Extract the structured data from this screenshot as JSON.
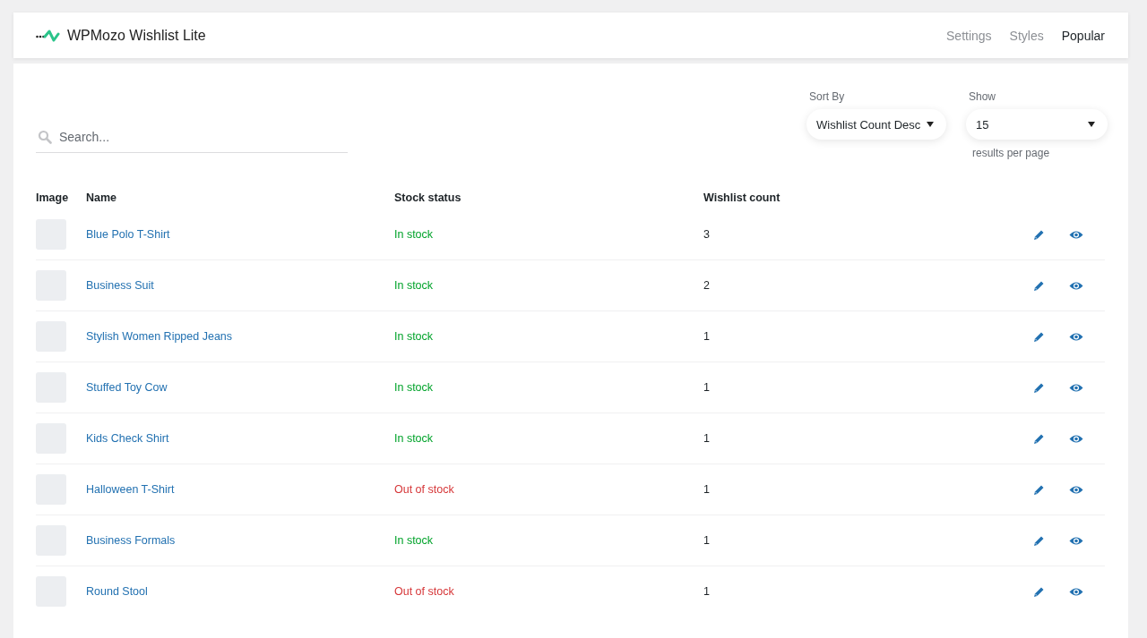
{
  "header": {
    "title": "WPMozo Wishlist Lite",
    "nav": [
      {
        "label": "Settings",
        "selected": false
      },
      {
        "label": "Styles",
        "selected": false
      },
      {
        "label": "Popular",
        "selected": true
      }
    ]
  },
  "search": {
    "placeholder": "Search..."
  },
  "sort": {
    "label": "Sort By",
    "value": "Wishlist Count Desc"
  },
  "show": {
    "label": "Show",
    "value": "15",
    "hint": "results per page"
  },
  "table": {
    "columns": [
      "Image",
      "Name",
      "Stock status",
      "Wishlist count"
    ],
    "rows": [
      {
        "name": "Blue Polo T-Shirt",
        "stock": "In stock",
        "in_stock": true,
        "count": "3"
      },
      {
        "name": "Business Suit",
        "stock": "In stock",
        "in_stock": true,
        "count": "2"
      },
      {
        "name": "Stylish Women Ripped Jeans",
        "stock": "In stock",
        "in_stock": true,
        "count": "1"
      },
      {
        "name": "Stuffed Toy Cow",
        "stock": "In stock",
        "in_stock": true,
        "count": "1"
      },
      {
        "name": "Kids Check Shirt",
        "stock": "In stock",
        "in_stock": true,
        "count": "1"
      },
      {
        "name": "Halloween T-Shirt",
        "stock": "Out of stock",
        "in_stock": false,
        "count": "1"
      },
      {
        "name": "Business Formals",
        "stock": "In stock",
        "in_stock": true,
        "count": "1"
      },
      {
        "name": "Round Stool",
        "stock": "Out of stock",
        "in_stock": false,
        "count": "1"
      }
    ]
  }
}
